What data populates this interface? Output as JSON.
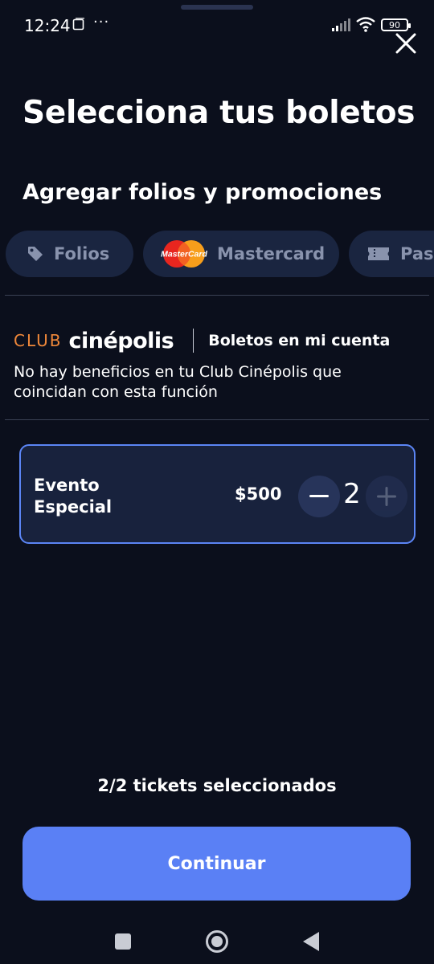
{
  "status_bar": {
    "time": "12:24",
    "battery": "90",
    "more_glyph": "···"
  },
  "header": {
    "title": "Selecciona tus boletos",
    "subtitle": "Agregar folios y promociones"
  },
  "chips": [
    {
      "label": "Folios",
      "icon": "tag-icon"
    },
    {
      "label": "Mastercard",
      "icon": "mastercard-logo",
      "logo_text": "MasterCard"
    },
    {
      "label": "Pase",
      "icon": "ticket-icon"
    }
  ],
  "club": {
    "brand_club": "CLUB",
    "brand_name": "cinépolis",
    "account_label": "Boletos en mi cuenta",
    "message": "No hay beneficios en tu Club Cinépolis que coincidan con esta función"
  },
  "ticket": {
    "name": "Evento Especial",
    "price": "$500",
    "quantity": "2"
  },
  "footer": {
    "tickets_selected": "2/2 tickets seleccionados",
    "continue_label": "Continuar"
  },
  "colors": {
    "background": "#0b0f1c",
    "card": "#18223d",
    "accent": "#5a80f5",
    "club_orange": "#f0883a"
  }
}
